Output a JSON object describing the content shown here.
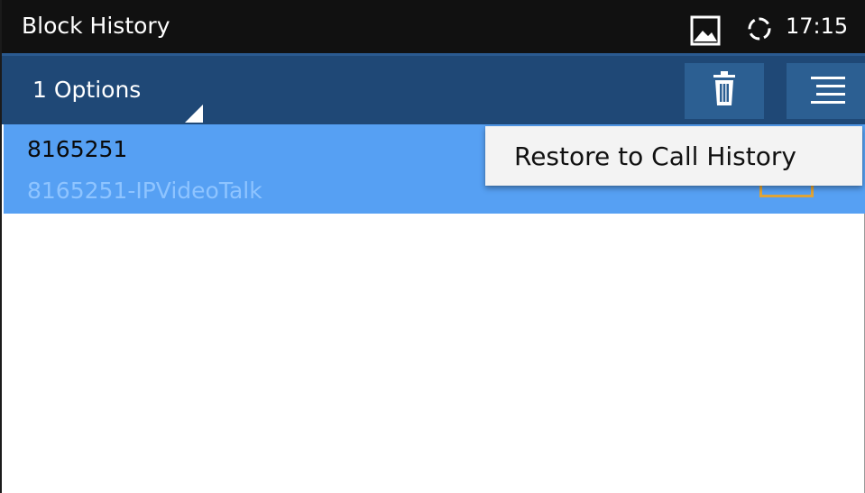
{
  "statusbar": {
    "title": "Block History",
    "clock": "17:15",
    "icons": [
      "image-notification-icon",
      "sync-icon"
    ]
  },
  "actionbar": {
    "options_label": "1 Options",
    "buttons": [
      "delete-icon",
      "menu-icon"
    ]
  },
  "list": {
    "items": [
      {
        "number": "8165251",
        "subtitle": "8165251-IPVideoTalk",
        "selected": true
      }
    ]
  },
  "popup": {
    "items": [
      {
        "label": "Restore to Call History"
      }
    ]
  },
  "colors": {
    "statusbar_bg": "#111111",
    "actionbar_bg": "#1f4876",
    "button_bg": "#2c5f92",
    "selected_row_bg": "#56a0f3",
    "checkbox_accent": "#e0a437"
  }
}
